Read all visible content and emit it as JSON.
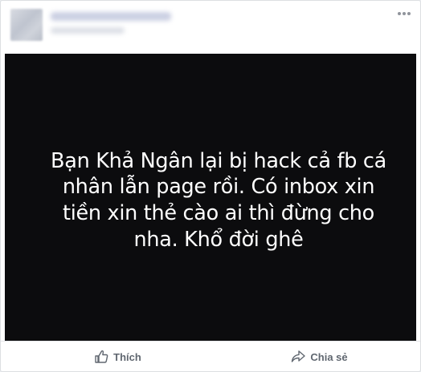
{
  "post": {
    "text": "Bạn Khả Ngân lại bị hack cả fb cá nhân lẫn page rồi. Có inbox xin tiền xin thẻ cào ai thì đừng cho nha. Khổ đời ghê"
  },
  "actions": {
    "like_label": "Thích",
    "share_label": "Chia sẻ"
  },
  "icons": {
    "like": "thumbs-up-icon",
    "share": "share-arrow-icon",
    "more": "more-options-icon"
  },
  "colors": {
    "media_background": "#0c0c0e",
    "action_text": "#606770"
  }
}
